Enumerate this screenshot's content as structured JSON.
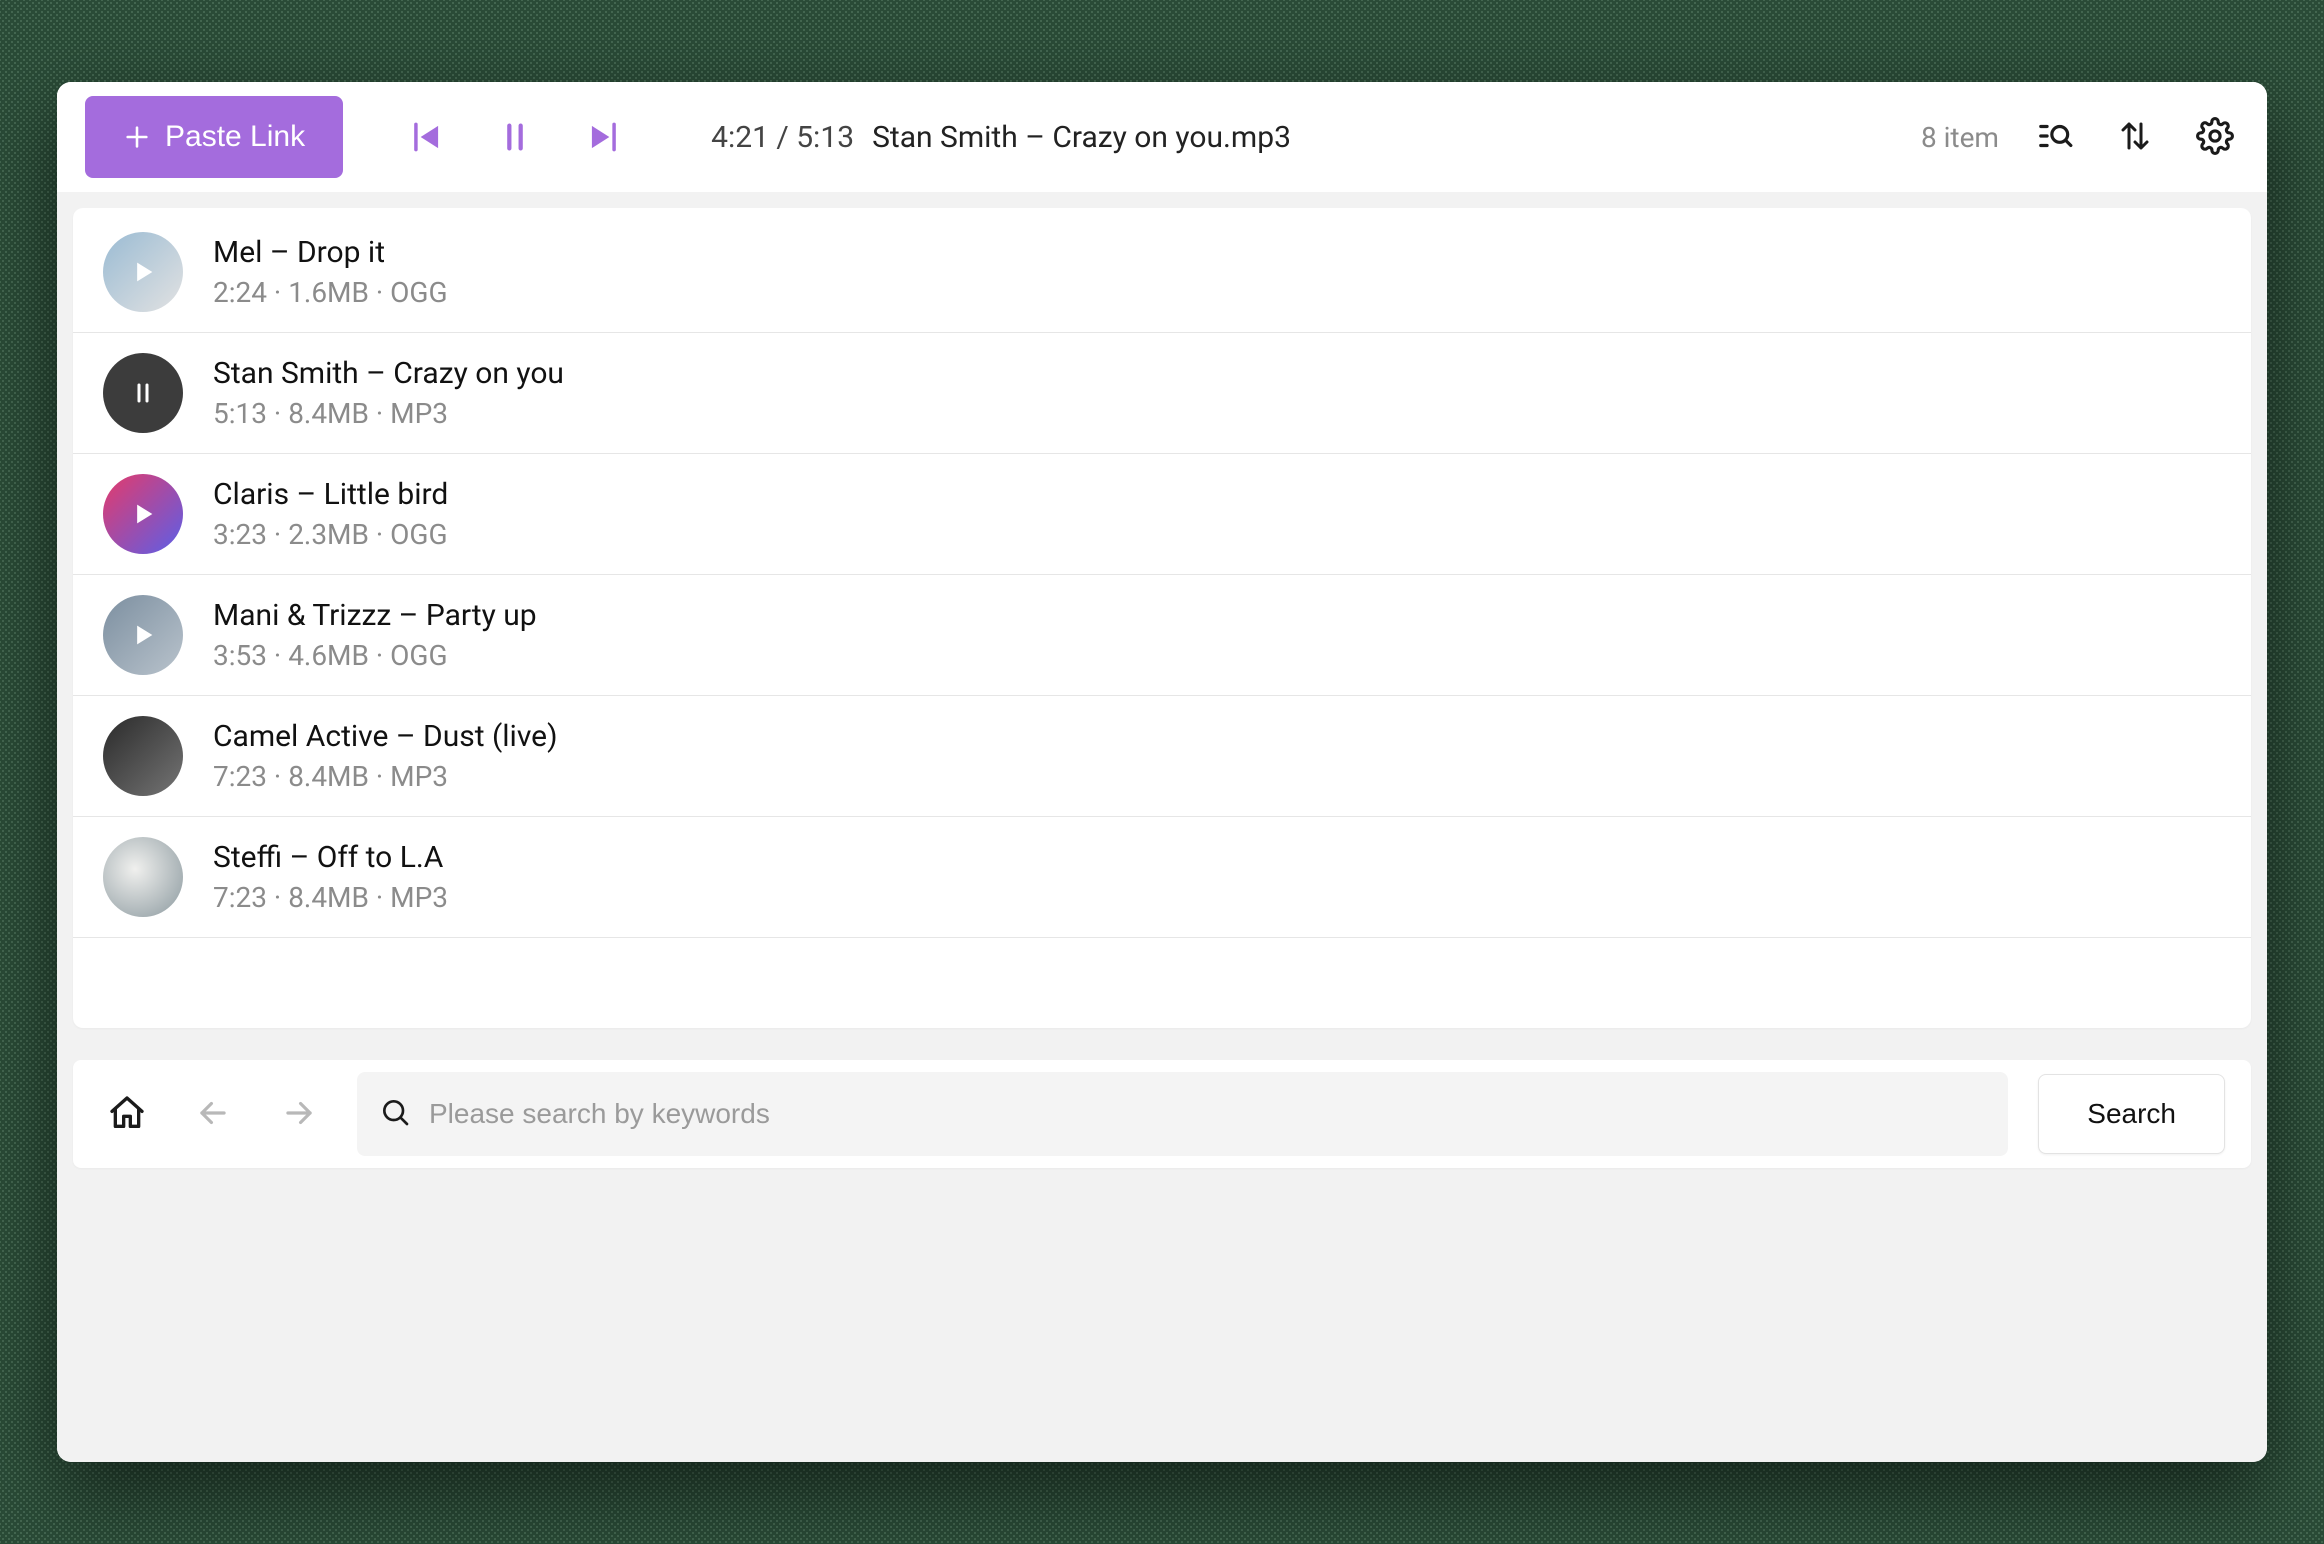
{
  "toolbar": {
    "paste_label": "Paste Link",
    "position": "4:21 / 5:13",
    "now_playing": "Stan Smith – Crazy on you.mp3",
    "count_label": "8 item"
  },
  "tracks": [
    {
      "title": "Mel – Drop it",
      "meta": "2:24 · 1.6MB · OGG",
      "overlay": "play"
    },
    {
      "title": "Stan Smith – Crazy on you",
      "meta": "5:13 · 8.4MB · MP3",
      "overlay": "pause"
    },
    {
      "title": "Claris – Little bird",
      "meta": "3:23 · 2.3MB · OGG",
      "overlay": "play"
    },
    {
      "title": "Mani & Trizzz – Party up",
      "meta": "3:53 · 4.6MB · OGG",
      "overlay": "play"
    },
    {
      "title": "Camel Active – Dust (live)",
      "meta": "7:23 · 8.4MB · MP3",
      "overlay": "none"
    },
    {
      "title": "Steffi – Off to L.A",
      "meta": "7:23 · 8.4MB · MP3",
      "overlay": "none"
    }
  ],
  "search": {
    "placeholder": "Please search by keywords",
    "value": "",
    "button_label": "Search"
  }
}
